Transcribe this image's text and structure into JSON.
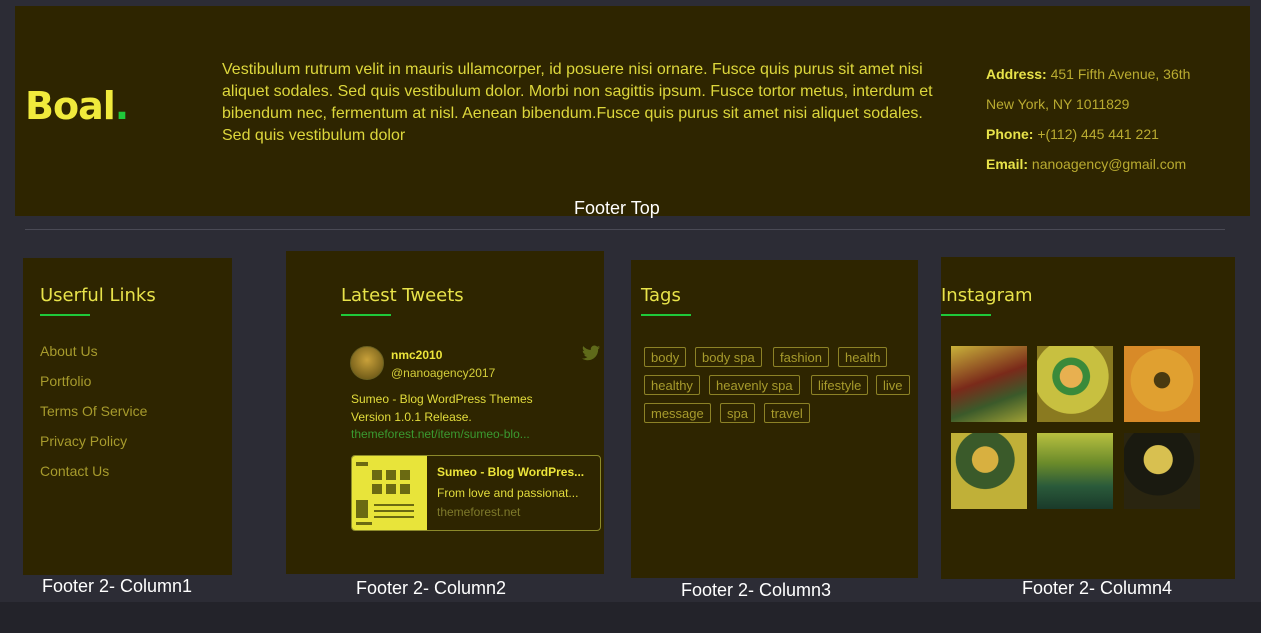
{
  "footer_top": {
    "logo": "Boal",
    "logo_dot": ".",
    "about": "Vestibulum rutrum velit in mauris ullamcorper, id posuere nisi ornare. Fusce quis purus sit amet nisi aliquet sodales. Sed quis vestibulum dolor. Morbi non sagittis ipsum. Fusce tortor metus, interdum et bibendum nec, fermentum at nisl. Aenean bibendum.Fusce quis purus sit amet nisi aliquet sodales. Sed quis vestibulum dolor",
    "address_label": "Address:",
    "address_line1": "451 Fifth Avenue, 36th",
    "address_line2": "New York, NY 1011829",
    "phone_label": "Phone:",
    "phone": "+(112) 445 441 221",
    "email_label": "Email:",
    "email": "nanoagency@gmail.com",
    "caption": "Footer Top"
  },
  "col1": {
    "title": "Userful Links",
    "links": [
      "About Us",
      "Portfolio",
      "Terms Of Service",
      "Privacy Policy",
      "Contact Us"
    ],
    "caption": "Footer 2- Column1"
  },
  "col2": {
    "title": "Latest Tweets",
    "user": "nmc2010",
    "handle": "@nanoagency2017",
    "text": "Sumeo - Blog WordPress Themes Version 1.0.1 Release.",
    "link": "themeforest.net/item/sumeo-blo...",
    "card_title": "Sumeo - Blog WordPres...",
    "card_desc": "From love and passionat...",
    "card_site": "themeforest.net",
    "caption": "Footer 2- Column2"
  },
  "col3": {
    "title": "Tags",
    "tags": [
      "body",
      "body spa",
      "fashion",
      "health",
      "healthy",
      "heavenly spa",
      "lifestyle",
      "live",
      "message",
      "spa",
      "travel"
    ],
    "caption": "Footer 2- Column3"
  },
  "col4": {
    "title": "Instagram",
    "photos": [
      "athlete-photo",
      "chef-photo",
      "runner-photo",
      "man-with-dog-photo",
      "whale-photo",
      "singer-photo"
    ],
    "caption": "Footer 2- Column4"
  },
  "colors": {
    "panel_bg": "#2e2500",
    "page_bg": "#2c2c35",
    "accent_yellow": "#e8e34a",
    "accent_green": "#1fc93a",
    "muted_text": "#a79b2c"
  }
}
